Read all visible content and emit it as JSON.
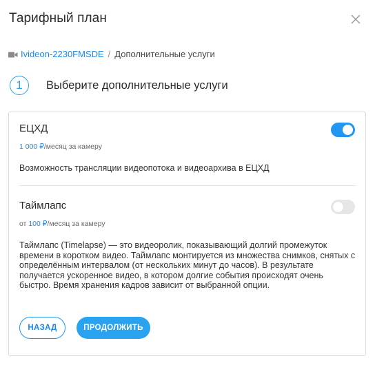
{
  "dialog": {
    "title": "Тарифный план"
  },
  "breadcrumb": {
    "camera": "Ivideon-2230FMSDE",
    "separator": "/",
    "current": "Дополнительные услуги"
  },
  "step": {
    "number": "1",
    "label": "Выберите дополнительные услуги"
  },
  "services": [
    {
      "name": "ЕЦХД",
      "price_prefix": "",
      "price_amount": "1 000 ₽",
      "price_suffix": "/месяц за камеру",
      "description": "Возможность трансляции видеопотока и видеоархива в ЕЦХД",
      "enabled": true
    },
    {
      "name": "Таймлапс",
      "price_prefix": "от ",
      "price_amount": "100 ₽",
      "price_suffix": "/месяц за камеру",
      "description": "Таймлапс (Timelapse) — это видеоролик, показывающий долгий промежуток времени в коротком видео. Таймлапс монтируется из множества снимков, снятых с определённым интервалом (от нескольких минут до часов). В результате получается ускоренное видео, в котором долгие события происходят очень быстро. Время хранения кадров зависит от выбранной опции.",
      "enabled": false
    }
  ],
  "buttons": {
    "back": "НАЗАД",
    "continue": "ПРОДОЛЖИТЬ"
  },
  "colors": {
    "accent": "#2196f3",
    "button_fill": "#29a3ef",
    "toggle_off": "#e6e6e6"
  }
}
